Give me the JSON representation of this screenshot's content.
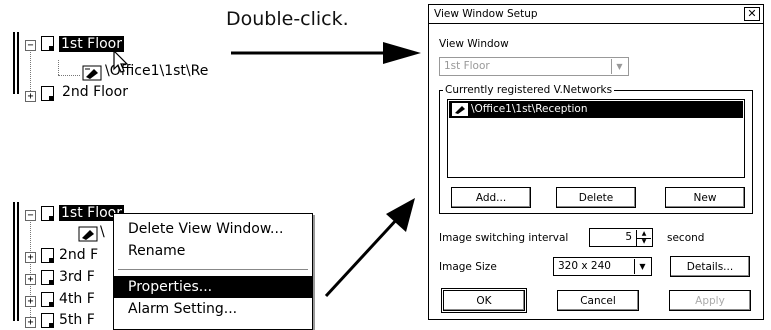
{
  "caption": "Double-click.",
  "tree_top": {
    "items": [
      {
        "label": "1st Floor",
        "selected": true
      },
      {
        "label": "\\Office1\\1st\\Re"
      },
      {
        "label": "2nd Floor"
      }
    ]
  },
  "tree_bottom": {
    "items": [
      {
        "label": "1st Floor",
        "selected": true
      },
      {
        "label": "\\"
      },
      {
        "label": "2nd F"
      },
      {
        "label": "3rd F"
      },
      {
        "label": "4th F"
      },
      {
        "label": "5th F"
      }
    ]
  },
  "context_menu": {
    "items": [
      {
        "label": "Delete View Window..."
      },
      {
        "label": "Rename"
      },
      {
        "label": "Properties...",
        "highlighted": true
      },
      {
        "label": "Alarm Setting..."
      }
    ]
  },
  "dialog": {
    "title": "View Window Setup",
    "close_symbol": "✕",
    "view_window_label": "View Window",
    "view_window_value": "1st Floor",
    "group_label": "Currently registered V.Networks",
    "list_items": [
      {
        "label": "\\Office1\\1st\\Reception",
        "highlighted": true
      }
    ],
    "buttons": {
      "add": "Add...",
      "delete": "Delete",
      "new": "New"
    },
    "interval_label": "Image switching interval",
    "interval_value": "5",
    "interval_unit": "second",
    "image_size_label": "Image Size",
    "image_size_value": "320 x 240",
    "details": "Details...",
    "ok": "OK",
    "cancel": "Cancel",
    "apply": "Apply"
  },
  "colors": {
    "selection": "#000000",
    "background": "#ffffff",
    "disabled_text": "#aaaaaa"
  }
}
